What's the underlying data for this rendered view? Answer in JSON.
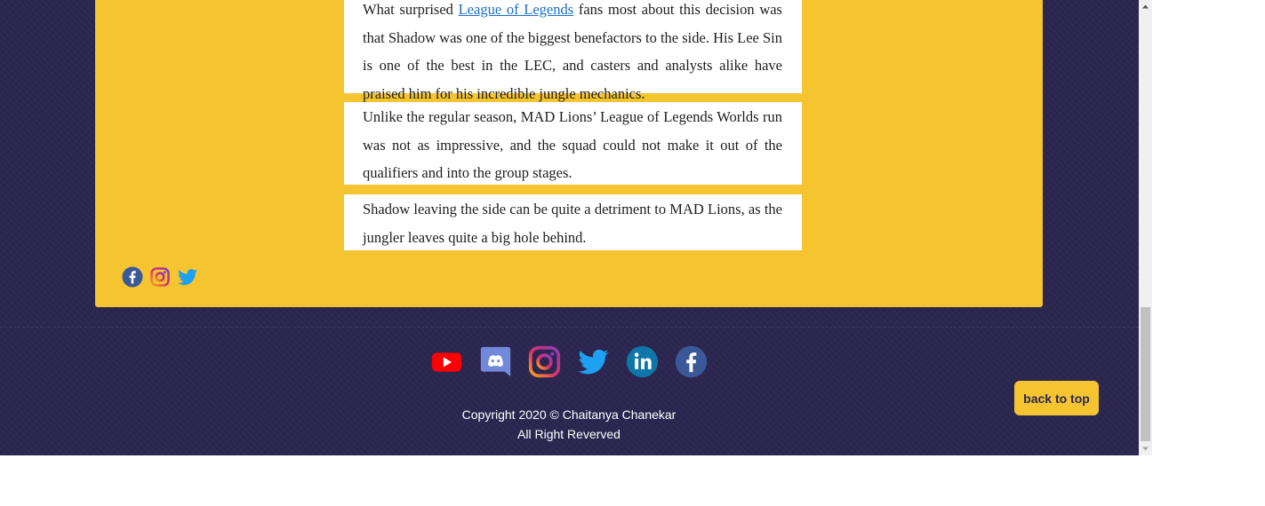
{
  "article": {
    "para1": {
      "prefix": "What surprised ",
      "link": "League of Legends",
      "suffix": " fans most about this decision was that Shadow was one of the biggest benefactors to the side. His Lee Sin is one of the best in the LEC, and casters and analysts alike have praised him for his incredible jungle mechanics."
    },
    "para2": "Unlike the regular season, MAD Lions’ League of Legends Worlds run was not as impressive, and the squad could not make it out of the qualifiers and into the group stages.",
    "para3": "Shadow leaving the side can be quite a detriment to MAD Lions, as the jungler leaves quite a big hole behind."
  },
  "card_social": [
    {
      "name": "facebook-icon",
      "color": "#3b5998"
    },
    {
      "name": "instagram-icon",
      "color": "#c13584"
    },
    {
      "name": "twitter-icon",
      "color": "#1da1f2"
    }
  ],
  "footer": {
    "icons": [
      {
        "name": "youtube-icon",
        "color": "#ff0000"
      },
      {
        "name": "discord-icon",
        "color": "#7289da"
      },
      {
        "name": "instagram-icon",
        "color": "#e1306c"
      },
      {
        "name": "twitter-icon",
        "color": "#1da1f2"
      },
      {
        "name": "linkedin-icon",
        "color": "#0e76a8"
      },
      {
        "name": "facebook-icon",
        "color": "#3b5998"
      }
    ],
    "copyright_line1": "Copyright 2020 © Chaitanya Chanekar",
    "copyright_line2": "All Right Reverved"
  },
  "back_to_top_label": "back to top",
  "colors": {
    "background": "#2b2650",
    "accent": "#f5c431",
    "link": "#1a6fc9"
  }
}
